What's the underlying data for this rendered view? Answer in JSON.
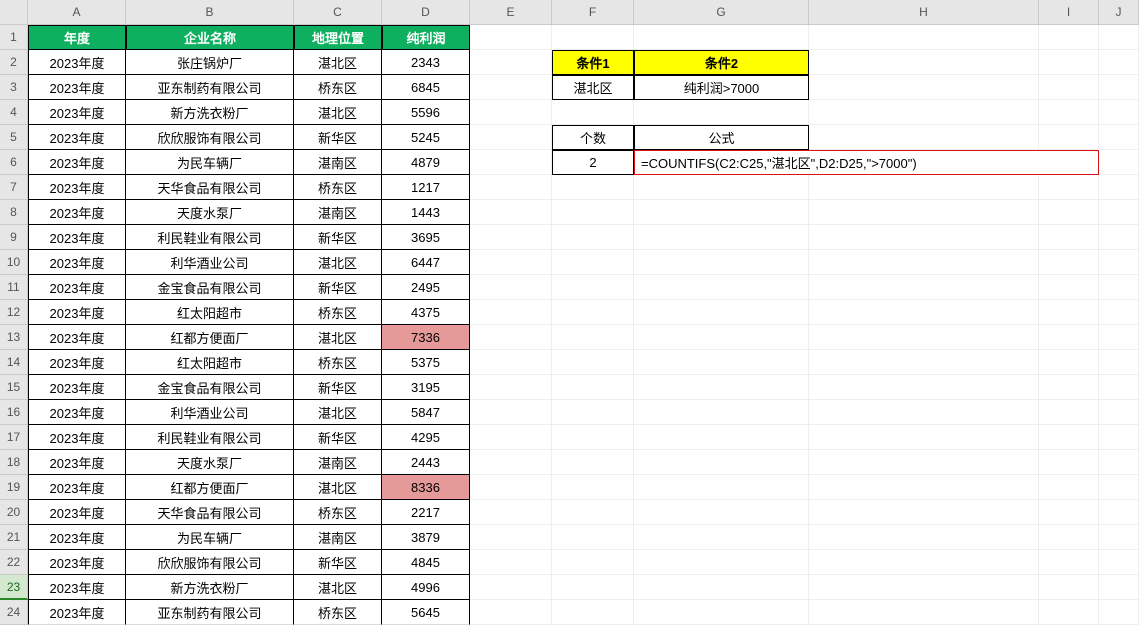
{
  "columns": [
    "",
    "A",
    "B",
    "C",
    "D",
    "E",
    "F",
    "G",
    "H",
    "I",
    "J"
  ],
  "headers": {
    "A": "年度",
    "B": "企业名称",
    "C": "地理位置",
    "D": "纯利润"
  },
  "rows": [
    {
      "n": 2,
      "A": "2023年度",
      "B": "张庄锅炉厂",
      "C": "湛北区",
      "D": "2343"
    },
    {
      "n": 3,
      "A": "2023年度",
      "B": "亚东制药有限公司",
      "C": "桥东区",
      "D": "6845"
    },
    {
      "n": 4,
      "A": "2023年度",
      "B": "新方洗衣粉厂",
      "C": "湛北区",
      "D": "5596"
    },
    {
      "n": 5,
      "A": "2023年度",
      "B": "欣欣服饰有限公司",
      "C": "新华区",
      "D": "5245"
    },
    {
      "n": 6,
      "A": "2023年度",
      "B": "为民车辆厂",
      "C": "湛南区",
      "D": "4879"
    },
    {
      "n": 7,
      "A": "2023年度",
      "B": "天华食品有限公司",
      "C": "桥东区",
      "D": "1217"
    },
    {
      "n": 8,
      "A": "2023年度",
      "B": "天度水泵厂",
      "C": "湛南区",
      "D": "1443"
    },
    {
      "n": 9,
      "A": "2023年度",
      "B": "利民鞋业有限公司",
      "C": "新华区",
      "D": "3695"
    },
    {
      "n": 10,
      "A": "2023年度",
      "B": "利华酒业公司",
      "C": "湛北区",
      "D": "6447"
    },
    {
      "n": 11,
      "A": "2023年度",
      "B": "金宝食品有限公司",
      "C": "新华区",
      "D": "2495"
    },
    {
      "n": 12,
      "A": "2023年度",
      "B": "红太阳超市",
      "C": "桥东区",
      "D": "4375"
    },
    {
      "n": 13,
      "A": "2023年度",
      "B": "红都方便面厂",
      "C": "湛北区",
      "D": "7336",
      "hl": true
    },
    {
      "n": 14,
      "A": "2023年度",
      "B": "红太阳超市",
      "C": "桥东区",
      "D": "5375"
    },
    {
      "n": 15,
      "A": "2023年度",
      "B": "金宝食品有限公司",
      "C": "新华区",
      "D": "3195"
    },
    {
      "n": 16,
      "A": "2023年度",
      "B": "利华酒业公司",
      "C": "湛北区",
      "D": "5847"
    },
    {
      "n": 17,
      "A": "2023年度",
      "B": "利民鞋业有限公司",
      "C": "新华区",
      "D": "4295"
    },
    {
      "n": 18,
      "A": "2023年度",
      "B": "天度水泵厂",
      "C": "湛南区",
      "D": "2443"
    },
    {
      "n": 19,
      "A": "2023年度",
      "B": "红都方便面厂",
      "C": "湛北区",
      "D": "8336",
      "hl": true
    },
    {
      "n": 20,
      "A": "2023年度",
      "B": "天华食品有限公司",
      "C": "桥东区",
      "D": "2217"
    },
    {
      "n": 21,
      "A": "2023年度",
      "B": "为民车辆厂",
      "C": "湛南区",
      "D": "3879"
    },
    {
      "n": 22,
      "A": "2023年度",
      "B": "欣欣服饰有限公司",
      "C": "新华区",
      "D": "4845"
    },
    {
      "n": 23,
      "A": "2023年度",
      "B": "新方洗衣粉厂",
      "C": "湛北区",
      "D": "4996",
      "sel": true
    },
    {
      "n": 24,
      "A": "2023年度",
      "B": "亚东制药有限公司",
      "C": "桥东区",
      "D": "5645"
    }
  ],
  "side": {
    "cond_header1": "条件1",
    "cond_header2": "条件2",
    "cond_val1": "湛北区",
    "cond_val2": "纯利润>7000",
    "count_label": "个数",
    "formula_label": "公式",
    "count_value": "2",
    "formula_text": "=COUNTIFS(C2:C25,\"湛北区\",D2:D25,\">7000\")"
  }
}
